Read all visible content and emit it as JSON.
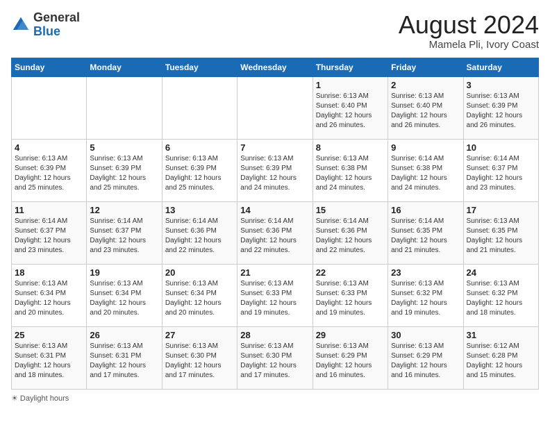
{
  "header": {
    "logo_general": "General",
    "logo_blue": "Blue",
    "month_year": "August 2024",
    "location": "Mamela Pli, Ivory Coast"
  },
  "weekdays": [
    "Sunday",
    "Monday",
    "Tuesday",
    "Wednesday",
    "Thursday",
    "Friday",
    "Saturday"
  ],
  "weeks": [
    [
      {
        "day": "",
        "info": ""
      },
      {
        "day": "",
        "info": ""
      },
      {
        "day": "",
        "info": ""
      },
      {
        "day": "",
        "info": ""
      },
      {
        "day": "1",
        "info": "Sunrise: 6:13 AM\nSunset: 6:40 PM\nDaylight: 12 hours\nand 26 minutes."
      },
      {
        "day": "2",
        "info": "Sunrise: 6:13 AM\nSunset: 6:40 PM\nDaylight: 12 hours\nand 26 minutes."
      },
      {
        "day": "3",
        "info": "Sunrise: 6:13 AM\nSunset: 6:39 PM\nDaylight: 12 hours\nand 26 minutes."
      }
    ],
    [
      {
        "day": "4",
        "info": "Sunrise: 6:13 AM\nSunset: 6:39 PM\nDaylight: 12 hours\nand 25 minutes."
      },
      {
        "day": "5",
        "info": "Sunrise: 6:13 AM\nSunset: 6:39 PM\nDaylight: 12 hours\nand 25 minutes."
      },
      {
        "day": "6",
        "info": "Sunrise: 6:13 AM\nSunset: 6:39 PM\nDaylight: 12 hours\nand 25 minutes."
      },
      {
        "day": "7",
        "info": "Sunrise: 6:13 AM\nSunset: 6:39 PM\nDaylight: 12 hours\nand 24 minutes."
      },
      {
        "day": "8",
        "info": "Sunrise: 6:13 AM\nSunset: 6:38 PM\nDaylight: 12 hours\nand 24 minutes."
      },
      {
        "day": "9",
        "info": "Sunrise: 6:14 AM\nSunset: 6:38 PM\nDaylight: 12 hours\nand 24 minutes."
      },
      {
        "day": "10",
        "info": "Sunrise: 6:14 AM\nSunset: 6:37 PM\nDaylight: 12 hours\nand 23 minutes."
      }
    ],
    [
      {
        "day": "11",
        "info": "Sunrise: 6:14 AM\nSunset: 6:37 PM\nDaylight: 12 hours\nand 23 minutes."
      },
      {
        "day": "12",
        "info": "Sunrise: 6:14 AM\nSunset: 6:37 PM\nDaylight: 12 hours\nand 23 minutes."
      },
      {
        "day": "13",
        "info": "Sunrise: 6:14 AM\nSunset: 6:36 PM\nDaylight: 12 hours\nand 22 minutes."
      },
      {
        "day": "14",
        "info": "Sunrise: 6:14 AM\nSunset: 6:36 PM\nDaylight: 12 hours\nand 22 minutes."
      },
      {
        "day": "15",
        "info": "Sunrise: 6:14 AM\nSunset: 6:36 PM\nDaylight: 12 hours\nand 22 minutes."
      },
      {
        "day": "16",
        "info": "Sunrise: 6:14 AM\nSunset: 6:35 PM\nDaylight: 12 hours\nand 21 minutes."
      },
      {
        "day": "17",
        "info": "Sunrise: 6:13 AM\nSunset: 6:35 PM\nDaylight: 12 hours\nand 21 minutes."
      }
    ],
    [
      {
        "day": "18",
        "info": "Sunrise: 6:13 AM\nSunset: 6:34 PM\nDaylight: 12 hours\nand 20 minutes."
      },
      {
        "day": "19",
        "info": "Sunrise: 6:13 AM\nSunset: 6:34 PM\nDaylight: 12 hours\nand 20 minutes."
      },
      {
        "day": "20",
        "info": "Sunrise: 6:13 AM\nSunset: 6:34 PM\nDaylight: 12 hours\nand 20 minutes."
      },
      {
        "day": "21",
        "info": "Sunrise: 6:13 AM\nSunset: 6:33 PM\nDaylight: 12 hours\nand 19 minutes."
      },
      {
        "day": "22",
        "info": "Sunrise: 6:13 AM\nSunset: 6:33 PM\nDaylight: 12 hours\nand 19 minutes."
      },
      {
        "day": "23",
        "info": "Sunrise: 6:13 AM\nSunset: 6:32 PM\nDaylight: 12 hours\nand 19 minutes."
      },
      {
        "day": "24",
        "info": "Sunrise: 6:13 AM\nSunset: 6:32 PM\nDaylight: 12 hours\nand 18 minutes."
      }
    ],
    [
      {
        "day": "25",
        "info": "Sunrise: 6:13 AM\nSunset: 6:31 PM\nDaylight: 12 hours\nand 18 minutes."
      },
      {
        "day": "26",
        "info": "Sunrise: 6:13 AM\nSunset: 6:31 PM\nDaylight: 12 hours\nand 17 minutes."
      },
      {
        "day": "27",
        "info": "Sunrise: 6:13 AM\nSunset: 6:30 PM\nDaylight: 12 hours\nand 17 minutes."
      },
      {
        "day": "28",
        "info": "Sunrise: 6:13 AM\nSunset: 6:30 PM\nDaylight: 12 hours\nand 17 minutes."
      },
      {
        "day": "29",
        "info": "Sunrise: 6:13 AM\nSunset: 6:29 PM\nDaylight: 12 hours\nand 16 minutes."
      },
      {
        "day": "30",
        "info": "Sunrise: 6:13 AM\nSunset: 6:29 PM\nDaylight: 12 hours\nand 16 minutes."
      },
      {
        "day": "31",
        "info": "Sunrise: 6:12 AM\nSunset: 6:28 PM\nDaylight: 12 hours\nand 15 minutes."
      }
    ]
  ],
  "legend": {
    "daylight_label": "Daylight hours"
  }
}
